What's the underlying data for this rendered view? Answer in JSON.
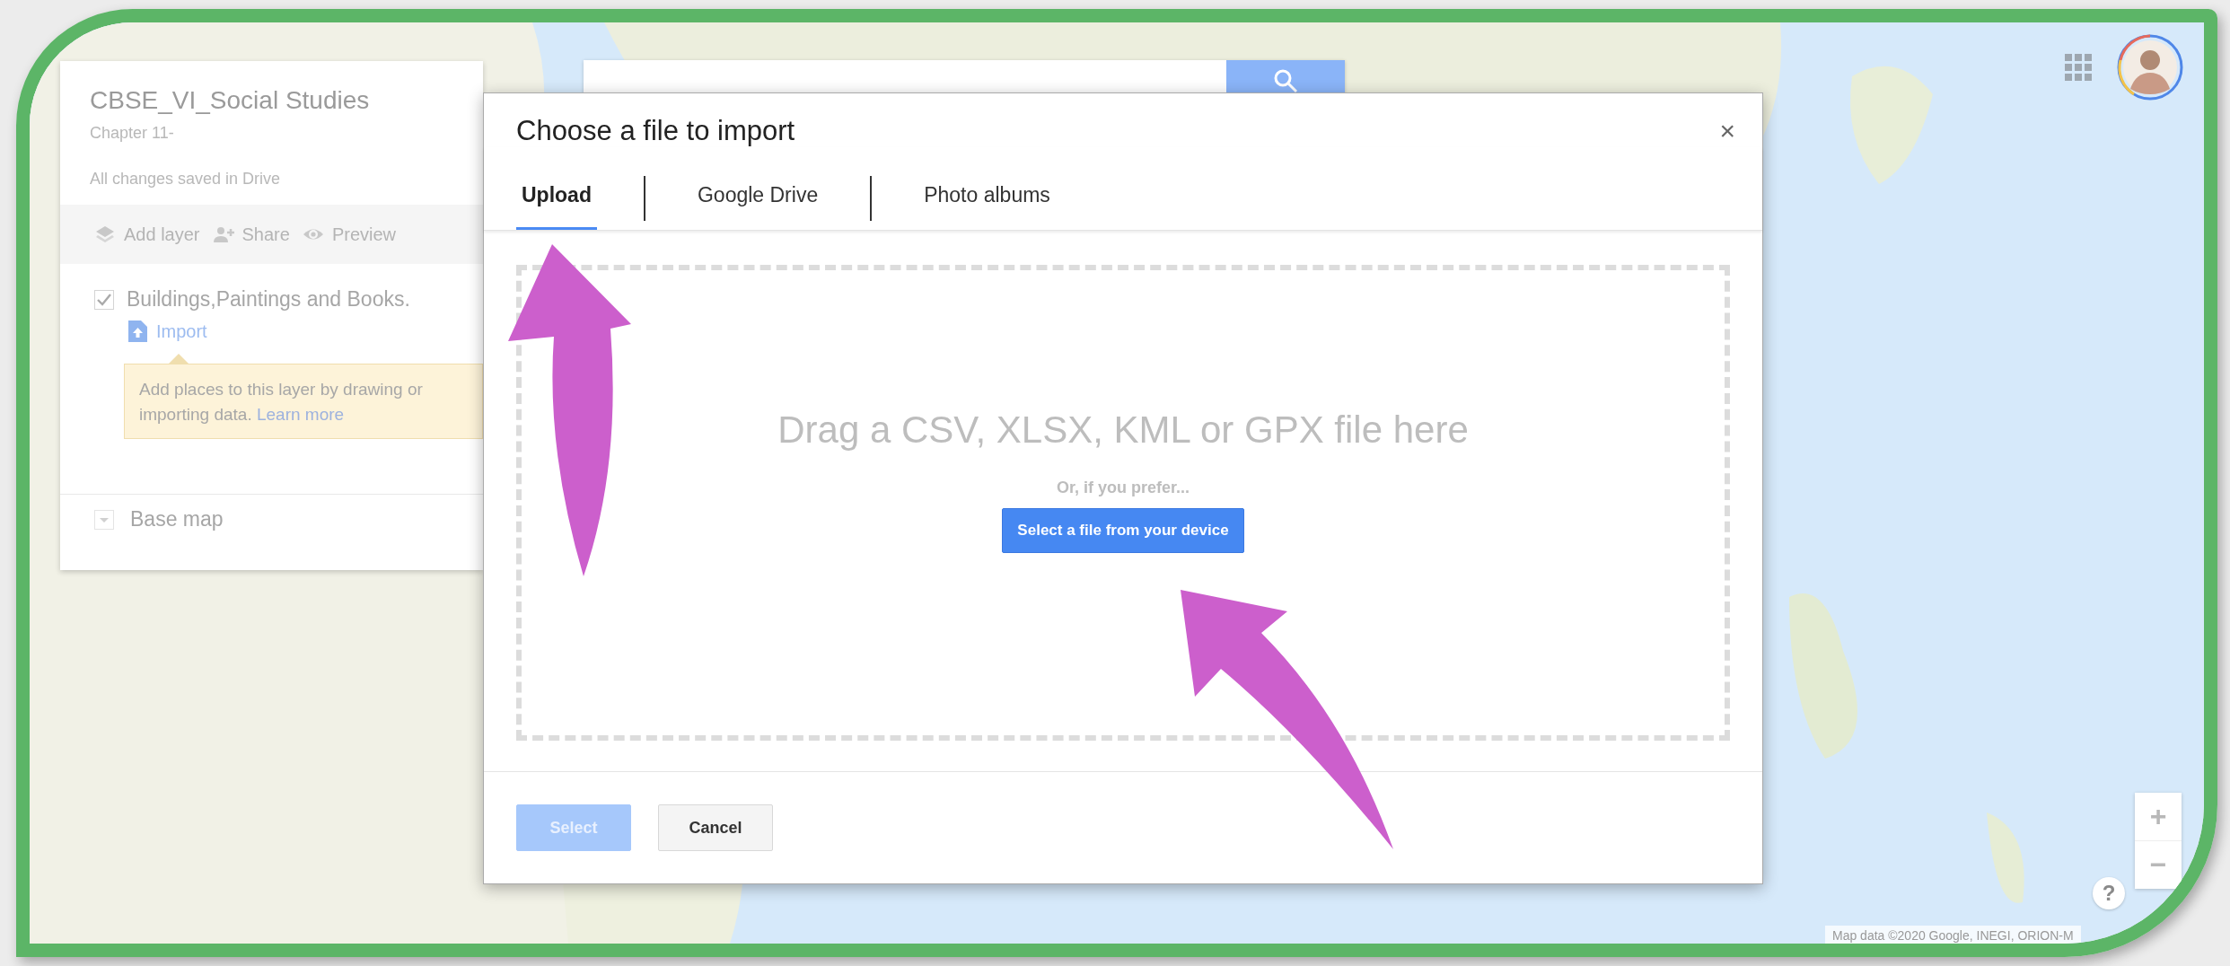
{
  "map_panel": {
    "title": "CBSE_VI_Social Studies",
    "description": "Chapter 11-",
    "save_status": "All changes saved in Drive",
    "actions": [
      {
        "kind": "layers",
        "label": "Add layer"
      },
      {
        "kind": "share",
        "label": "Share"
      },
      {
        "kind": "preview",
        "label": "Preview"
      }
    ],
    "layers": [
      {
        "name": "Buildings,Paintings and Books.",
        "checked": true,
        "import_link": "Import",
        "hint": "Add places to this layer by drawing or importing data.",
        "hint_link": "Learn more"
      }
    ],
    "base_map": {
      "label": "Base map"
    }
  },
  "map_controls": {
    "zoom_in": "+",
    "zoom_out": "−",
    "help": "?",
    "attribution": "Map data ©2020 Google, INEGI, ORION-M"
  },
  "dialog": {
    "title": "Choose a file to import",
    "close": "×",
    "tabs": [
      {
        "label": "Upload",
        "selected": true
      },
      {
        "label": "Google Drive",
        "selected": false
      },
      {
        "label": "Photo albums",
        "selected": false
      }
    ],
    "drop_zone": {
      "prompt": "Drag a CSV, XLSX, KML or GPX file here",
      "alternative": "Or, if you prefer...",
      "button": "Select a file from your device"
    },
    "buttons": [
      {
        "kind": "primary",
        "label": "Select",
        "disabled": true
      },
      {
        "kind": "secondary",
        "label": "Cancel",
        "disabled": false
      }
    ]
  }
}
